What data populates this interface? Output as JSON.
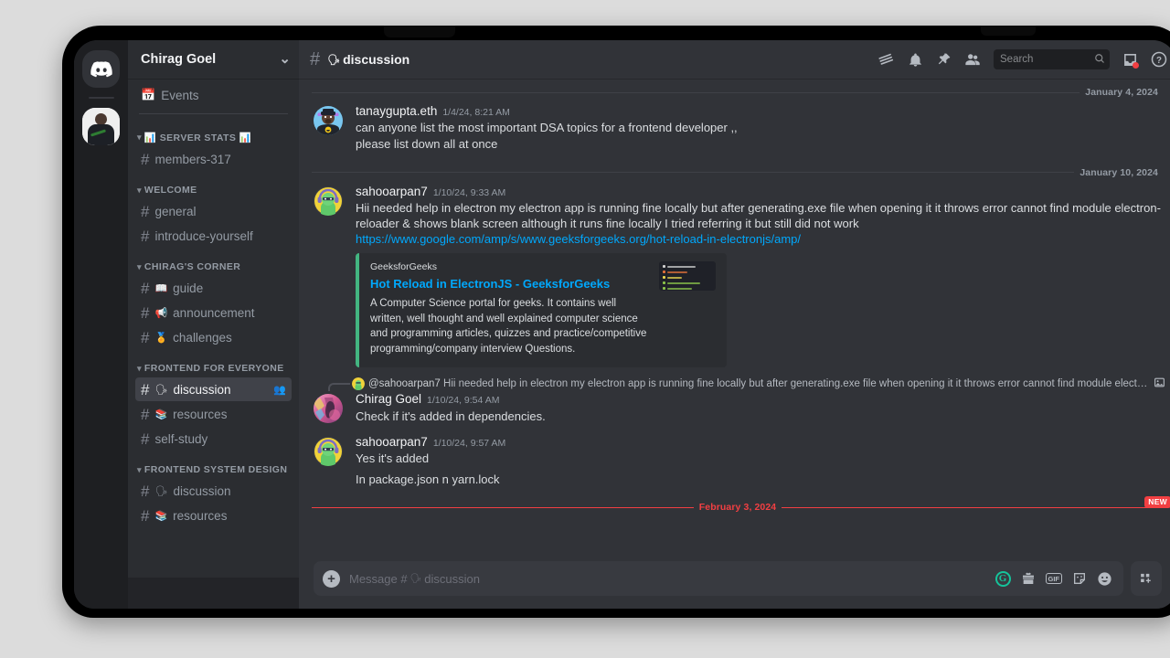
{
  "window": {
    "device_frame": "tablet",
    "background_color": "#dcdcdc"
  },
  "server_rail": {
    "home_icon": "discord-logo-icon",
    "servers": [
      {
        "name": "Chirag Goel",
        "active": true,
        "avatar": "photo-person-avatar"
      }
    ]
  },
  "sidebar": {
    "server_name": "Chirag Goel",
    "chevron": "⌄",
    "top_items": [
      {
        "label": "Events",
        "icon": "calendar-icon"
      }
    ],
    "categories": [
      {
        "label": "📊 SERVER STATS 📊",
        "name": "server-stats",
        "channels": [
          {
            "label": "members-317",
            "emoji": "",
            "active": false
          }
        ]
      },
      {
        "label": "WELCOME",
        "name": "welcome",
        "channels": [
          {
            "label": "general",
            "emoji": "",
            "active": false
          },
          {
            "label": "introduce-yourself",
            "emoji": "",
            "active": false
          }
        ]
      },
      {
        "label": "CHIRAG'S CORNER",
        "name": "chirags-corner",
        "channels": [
          {
            "label": "guide",
            "emoji": "📖",
            "active": false
          },
          {
            "label": "announcement",
            "emoji": "📢",
            "active": false
          },
          {
            "label": "challenges",
            "emoji": "🏅",
            "active": false
          }
        ]
      },
      {
        "label": "FRONTEND FOR EVERYONE",
        "name": "frontend-for-everyone",
        "channels": [
          {
            "label": "discussion",
            "emoji": "🗣",
            "active": true,
            "trailing_icon": "add-members-icon"
          },
          {
            "label": "resources",
            "emoji": "📚",
            "active": false
          },
          {
            "label": "self-study",
            "emoji": "",
            "active": false
          }
        ]
      },
      {
        "label": "FRONTEND SYSTEM DESIGN",
        "name": "frontend-system-design",
        "channels": [
          {
            "label": "discussion",
            "emoji": "🗣",
            "active": false
          },
          {
            "label": "resources",
            "emoji": "📚",
            "active": false
          }
        ]
      }
    ]
  },
  "channel_header": {
    "hash": "#",
    "emoji": "🗣",
    "title": "discussion",
    "icons": [
      {
        "name": "threads-icon"
      },
      {
        "name": "notifications-bell-icon"
      },
      {
        "name": "pinned-messages-icon"
      },
      {
        "name": "member-list-icon"
      }
    ],
    "search_placeholder": "Search",
    "inbox_icon": "inbox-icon",
    "help_icon": "help-icon"
  },
  "messages": [
    {
      "type": "divider",
      "label": "January 4, 2024"
    },
    {
      "type": "message",
      "author": "tanaygupta.eth",
      "timestamp": "1/4/24, 8:21 AM",
      "avatar": "bull-nft-avatar",
      "lines": [
        "can anyone list the most important  DSA topics for a frontend developer ,,",
        "please list down all at once"
      ]
    },
    {
      "type": "divider",
      "label": "January 10, 2024"
    },
    {
      "type": "message",
      "author": "sahooarpan7",
      "timestamp": "1/10/24, 9:33 AM",
      "avatar": "green-headphones-avatar",
      "text_before_link": "Hii needed help in electron my electron app is running fine locally but after generating.exe file when opening it it throws error cannot find module electron-reloader & shows blank screen  although it runs fine locally I tried referring it but still did not work ",
      "link": "https://www.google.com/amp/s/www.geeksforgeeks.org/hot-reload-in-electronjs/amp/",
      "embed": {
        "provider": "GeeksforGeeks",
        "title": "Hot Reload in ElectronJS - GeeksforGeeks",
        "description": "A Computer Science portal for geeks. It contains well written, well thought and well explained computer science and programming articles, quizzes and practice/competitive programming/company interview Questions.",
        "accent_color": "#43b581",
        "thumbnail": "code-editor-filetree-thumbnail",
        "thumbnail_lines": [
          {
            "label": "node_modules",
            "color": "#cfcfcf"
          },
          {
            "label": "index.html",
            "color": "#e2703a"
          },
          {
            "label": "main.js",
            "color": "#e8d44d"
          },
          {
            "label": "package-lock.json",
            "color": "#8bc34a"
          },
          {
            "label": "package.json",
            "color": "#8bc34a"
          }
        ]
      }
    },
    {
      "type": "reply",
      "reply_to_author": "@sahooarpan7",
      "reply_to_text": "Hii needed help in electron my electron app is running fine locally but after generating.exe file when opening it it throws error cannot find module electron-reload...",
      "reply_attachment_icon": "image-attachment-icon",
      "author": "Chirag Goel",
      "timestamp": "1/10/24, 9:54 AM",
      "avatar": "pink-abstract-avatar",
      "lines": [
        "Check if it's added in dependencies."
      ]
    },
    {
      "type": "message",
      "author": "sahooarpan7",
      "timestamp": "1/10/24, 9:57 AM",
      "avatar": "green-headphones-avatar",
      "lines": [
        "Yes it's added",
        "In package.json n yarn.lock"
      ]
    },
    {
      "type": "divider-new",
      "label": "February 3, 2024",
      "badge": "NEW",
      "badge_color": "#f23f42"
    }
  ],
  "composer": {
    "plus_label": "+",
    "placeholder_prefix": "Message #",
    "placeholder_emoji": "🗣",
    "placeholder_channel": "discussion",
    "icons": [
      {
        "name": "grammarly-icon",
        "glyph": "G"
      },
      {
        "name": "gift-icon"
      },
      {
        "name": "gif-icon",
        "label": "GIF"
      },
      {
        "name": "sticker-icon"
      },
      {
        "name": "emoji-icon"
      }
    ],
    "apps_icon": "apps-games-icon"
  }
}
